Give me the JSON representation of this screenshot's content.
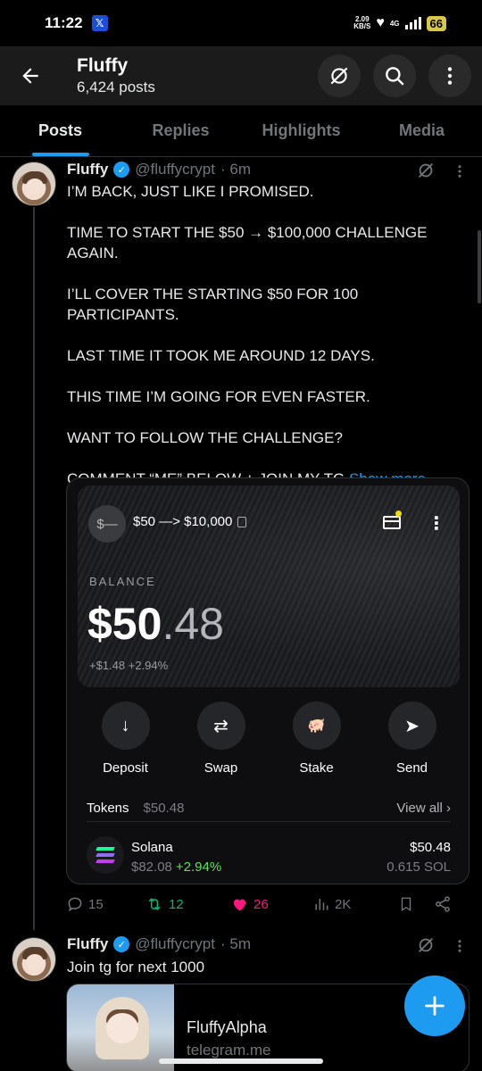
{
  "status_bar": {
    "time": "11:22",
    "app_icon": "x-logo-icon",
    "net_speed_value": "2.09",
    "net_speed_unit": "KB/S",
    "network": "4G",
    "battery": "66"
  },
  "header": {
    "name": "Fluffy",
    "posts_count": "6,424 posts",
    "icons": [
      "back-arrow-icon",
      "grok-icon",
      "search-icon",
      "more-vertical-icon"
    ]
  },
  "tabs": [
    {
      "label": "Posts",
      "active": true
    },
    {
      "label": "Replies",
      "active": false
    },
    {
      "label": "Highlights",
      "active": false
    },
    {
      "label": "Media",
      "active": false
    }
  ],
  "post1": {
    "name": "Fluffy",
    "handle": "@fluffycrypt",
    "time": "· 6m",
    "lines": [
      "I’M BACK, JUST LIKE I PROMISED.",
      "TIME TO START THE $50 → $100,000 CHALLENGE AGAIN.",
      "I’LL COVER THE STARTING $50 FOR 100 PARTICIPANTS.",
      "LAST TIME IT TOOK ME AROUND 12 DAYS.",
      "THIS TIME I’M GOING FOR EVEN FASTER.",
      "WANT TO FOLLOW THE CHALLENGE?",
      "COMMENT “ME” BELOW + JOIN MY TG"
    ],
    "show_more": "Show more",
    "wallet": {
      "icon_text": "$—",
      "title": "$50 —> $10,000",
      "balance_label": "BALANCE",
      "balance_dollars": "$50",
      "balance_cents": ".48",
      "change": "+$1.48 +2.94%",
      "actions": [
        {
          "label": "Deposit",
          "icon": "arrow-down-icon",
          "glyph": "↓"
        },
        {
          "label": "Swap",
          "icon": "swap-arrows-icon",
          "glyph": "⇄"
        },
        {
          "label": "Stake",
          "icon": "piggy-bank-icon",
          "glyph": "🐖"
        },
        {
          "label": "Send",
          "icon": "send-icon",
          "glyph": "➤"
        }
      ],
      "tokens_label": "Tokens",
      "tokens_value": "$50.48",
      "view_all": "View all",
      "token": {
        "name": "Solana",
        "price": "$82.08",
        "change": "+2.94%",
        "usd": "$50.48",
        "amount": "0.615 SOL"
      }
    },
    "engagement": {
      "replies": "15",
      "reposts": "12",
      "likes": "26",
      "views": "2K"
    }
  },
  "post2": {
    "name": "Fluffy",
    "handle": "@fluffycrypt",
    "time": "· 5m",
    "text": "Join tg for next 1000",
    "link_title": "FluffyAlpha",
    "link_url": "telegram.me"
  },
  "colors": {
    "accent": "#1d9bf0",
    "like": "#f91880",
    "repost": "#00ba7c",
    "positive": "#5ee15a"
  }
}
